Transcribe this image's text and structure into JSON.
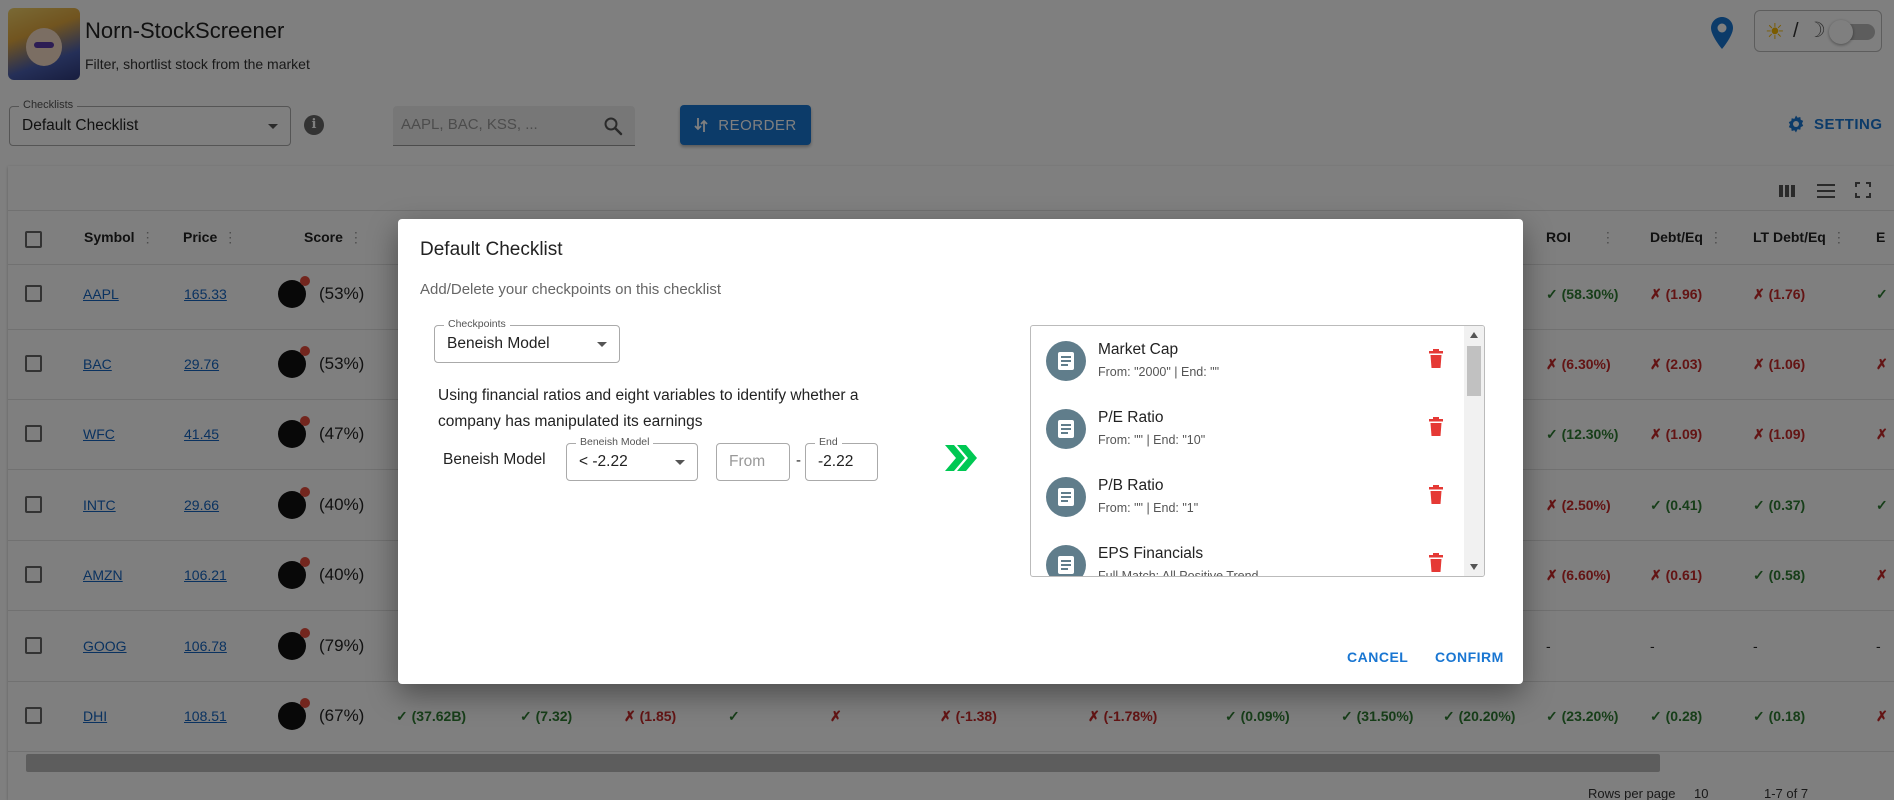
{
  "app": {
    "title": "Norn-StockScreener",
    "subtitle": "Filter, shortlist stock from the market",
    "theme": {
      "sun": "☀",
      "slash": "/",
      "moon": "☽"
    }
  },
  "controls": {
    "checklists_label": "Checklists",
    "checklists_value": "Default Checklist",
    "search_placeholder": "AAPL, BAC, KSS, ...",
    "reorder_label": "REORDER",
    "setting_label": "SETTING"
  },
  "table": {
    "headers": {
      "symbol": "Symbol",
      "price": "Price",
      "score": "Score",
      "roi": "ROI",
      "debt_eq": "Debt/Eq",
      "lt_debt_eq": "LT Debt/Eq",
      "es": "E"
    },
    "header_dots": "⋮",
    "rows": [
      {
        "symbol": "AAPL",
        "price": "165.33",
        "score": "(53%)",
        "roi": "✓ (58.30%)",
        "debt_eq": "✗ (1.96)",
        "lt_debt_eq": "✗ (1.76)",
        "es": "✓"
      },
      {
        "symbol": "BAC",
        "price": "29.76",
        "score": "(53%)",
        "roi": "✗ (6.30%)",
        "debt_eq": "✗ (2.03)",
        "lt_debt_eq": "✗ (1.06)",
        "es": "✗"
      },
      {
        "symbol": "WFC",
        "price": "41.45",
        "score": "(47%)",
        "roi": "✓ (12.30%)",
        "debt_eq": "✗ (1.09)",
        "lt_debt_eq": "✗ (1.09)",
        "es": "✗"
      },
      {
        "symbol": "INTC",
        "price": "29.66",
        "score": "(40%)",
        "roi": "✗ (2.50%)",
        "debt_eq": "✓ (0.41)",
        "lt_debt_eq": "✓ (0.37)",
        "es": "✓"
      },
      {
        "symbol": "AMZN",
        "price": "106.21",
        "score": "(40%)",
        "roi": "✗ (6.60%)",
        "debt_eq": "✗ (0.61)",
        "lt_debt_eq": "✓ (0.58)",
        "es": "✗"
      },
      {
        "symbol": "GOOG",
        "price": "106.78",
        "score": "(79%)",
        "roi": "-",
        "debt_eq": "-",
        "lt_debt_eq": "-",
        "es": "-"
      },
      {
        "symbol": "DHI",
        "price": "108.51",
        "score": "(67%)",
        "roi": "✓ (23.20%)",
        "debt_eq": "✓ (0.28)",
        "lt_debt_eq": "✓ (0.18)",
        "es": "✗"
      }
    ],
    "dhi_extra": [
      "✓ (37.62B)",
      "✓ (7.32)",
      "✗ (1.85)",
      "✓",
      "✗",
      "✗ (-1.38)",
      "✗ (-1.78%)",
      "✓ (0.09%)",
      "✓ (31.50%)",
      "✓ (20.20%)"
    ],
    "footer": {
      "rows_per_page_label": "Rows per page",
      "rows_per_page_value": "10",
      "range": "1-7 of 7"
    }
  },
  "dialog": {
    "title": "Default Checklist",
    "subtitle": "Add/Delete your checkpoints on this checklist",
    "checkpoints_label": "Checkpoints",
    "checkpoints_value": "Beneish Model",
    "description": "Using financial ratios and eight variables to identify whether a company has manipulated its earnings",
    "beneish_label": "Beneish Model",
    "operator_label": "Beneish Model",
    "operator_value": "< -2.22",
    "from_placeholder": "From",
    "dash": "-",
    "end_label": "End",
    "end_value": "-2.22",
    "checkpoints": [
      {
        "name": "Market Cap",
        "range": "From: \"2000\" | End: \"\""
      },
      {
        "name": "P/E Ratio",
        "range": "From: \"\" | End: \"10\""
      },
      {
        "name": "P/B Ratio",
        "range": "From: \"\" | End: \"1\""
      },
      {
        "name": "EPS Financials",
        "range": "Full Match: All Positive Trend"
      }
    ],
    "cancel_label": "CANCEL",
    "confirm_label": "CONFIRM"
  },
  "colors": {
    "primary": "#1976d2",
    "success": "#2e7d32",
    "error": "#c62828",
    "arrow": "#00c853",
    "avatar_bg": "#607d8b"
  }
}
